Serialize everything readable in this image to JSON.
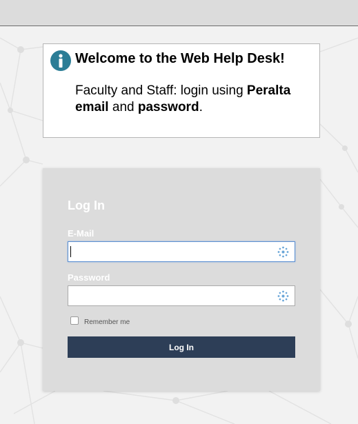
{
  "colors": {
    "topbar": "#dcdcdc",
    "page_background": "#f2f2f2",
    "info_icon": "#2b7d96",
    "panel": "#dcdcdc",
    "button": "#2d3e57",
    "focus_border": "#5b8fd1"
  },
  "welcome": {
    "icon": "info-icon",
    "title": "Welcome to the Web Help Desk!",
    "message_parts": {
      "prefix": "Faculty and Staff: login using ",
      "bold1": "Peralta email",
      "middle": " and ",
      "bold2": "password",
      "suffix": "."
    }
  },
  "login": {
    "title": "Log In",
    "email_label": "E-Mail",
    "email_value": "",
    "password_label": "Password",
    "password_value": "",
    "field_icon": "keypad-icon",
    "remember_label": "Remember me",
    "remember_checked": false,
    "button_label": "Log In"
  }
}
